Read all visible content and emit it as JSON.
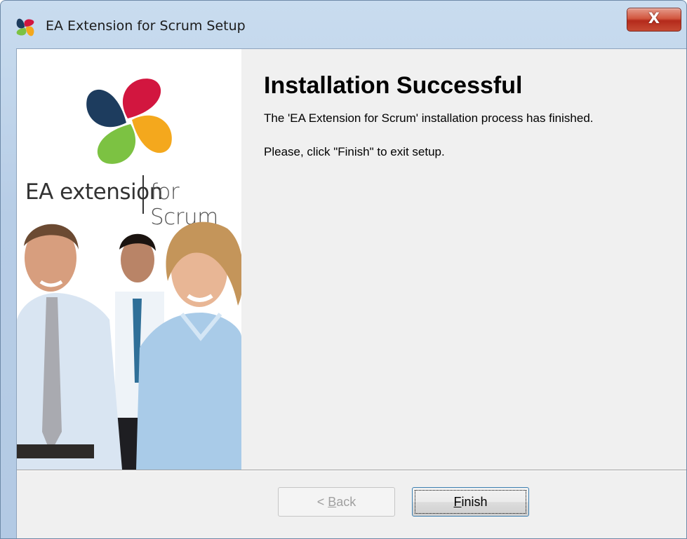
{
  "window": {
    "title": "EA Extension for Scrum Setup",
    "app_icon": "ea-scrum-logo-icon",
    "close_symbol": "X"
  },
  "side_panel": {
    "logo": "ea-scrum-logo",
    "brand_left": "EA extension",
    "brand_right": "for Scrum",
    "photo": "business-team-photo"
  },
  "content": {
    "heading": "Installation Successful",
    "message": "The 'EA Extension for Scrum' installation process has finished.",
    "instruction": "Please, click \"Finish\" to exit setup."
  },
  "buttons": {
    "back": {
      "prefix": "< ",
      "mnemonic": "B",
      "rest": "ack",
      "enabled": false
    },
    "finish": {
      "mnemonic": "F",
      "rest": "inish",
      "enabled": true,
      "focused": true
    }
  },
  "colors": {
    "logo_red": "#d2163f",
    "logo_orange": "#f4a81d",
    "logo_green": "#7cc242",
    "logo_navy": "#1d3c5e",
    "title_bar": "#c9dcef",
    "close_button": "#c64a33"
  }
}
